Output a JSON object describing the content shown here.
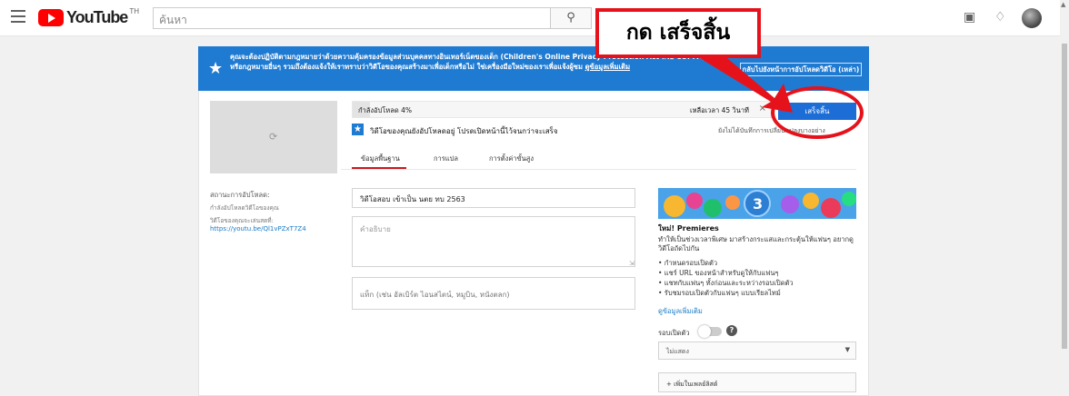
{
  "topbar": {
    "logo_text": "YouTube",
    "logo_region": "TH",
    "search_placeholder": "ค้นหา",
    "icons": [
      "menu-icon",
      "search-icon",
      "camera-icon",
      "bell-icon",
      "avatar"
    ]
  },
  "banner": {
    "text": "คุณจะต้องปฏิบัติตามกฎหมายว่าด้วยความคุ้มครองข้อมูลส่วนบุคคลทางอินเทอร์เน็ตของเด็ก (Children's Online Privacy Protection Act หรือ COPPA) และ/หรือกฎหมายอื่นๆ รวมถึงต้องแจ้งให้เราทราบว่าวิดีโอของคุณสร้างมาเพื่อเด็กหรือไม่ ใช่เครื่องมือใหม่ของเราเพื่อแจ้งผู้ชม",
    "link": "ดูข้อมูลเพิ่มเติม",
    "button": "กลับไปยังหน้าการอัปโหลดวิดีโอ (เหล่า)"
  },
  "upload": {
    "progress_label": "กำลังอัปโหลด 4%",
    "progress_percent": 4,
    "time_left": "เหลือเวลา 45 วินาที",
    "done_button": "เสร็จสิ้น",
    "status_message": "วิดีโอของคุณยังอัปโหลดอยู่ โปรดเปิดหน้านี้ไว้จนกว่าจะเสร็จ",
    "status_right": "ยังไม่ได้บันทึกการเปลี่ยนแปลงบางอย่าง"
  },
  "tabs": [
    "ข้อมูลพื้นฐาน",
    "การแปล",
    "การตั้งค่าขั้นสูง"
  ],
  "left": {
    "status_label": "สถานะการอัปโหลด:",
    "status_sub": "กำลังอัปโหลดวิดีโอของคุณ",
    "url_label": "วิดีโอของคุณจะเล่นสดที่:",
    "url": "https://youtu.be/Ql1vPZxT7Z4"
  },
  "form": {
    "title_value": "วิดีโอสอบ เข้าเป็น นตย ทบ  2563",
    "description_placeholder": "คำอธิบาย",
    "tags_placeholder": "แท็ก (เช่น อัลเบิร์ต ไอนสไตน์, หมูบิน, หนังตลก)"
  },
  "promo": {
    "number": "3",
    "title": "ใหม่! Premieres",
    "desc": "ทำให้เป็นช่วงเวลาพิเศษ มาสร้างกระแสและกระตุ้นให้แฟนๆ อยากดูวิดีโอถัดไปกัน",
    "bullets": [
      "• กำหนดรอบเปิดตัว",
      "• แชร์ URL ของหน้าสำหรับดูให้กับแฟนๆ",
      "• แชทกับแฟนๆ ทั้งก่อนและระหว่างรอบเปิดตัว",
      "• รับชมรอบเปิดตัวกับแฟนๆ แบบเรียลไทม์"
    ],
    "link": "ดูข้อมูลเพิ่มเติม",
    "premiere_label": "รอบเปิดตัว",
    "select_value": "ไม่แสดง",
    "playlist_button": "+ เพิ่มในเพลย์ลิสต์"
  },
  "callout": {
    "text": "กด เสร็จสิ้น"
  },
  "colors": {
    "banner_blue": "#1f7ad1",
    "annotation_red": "#e6121b",
    "done_button_blue": "#1d6dd6"
  }
}
